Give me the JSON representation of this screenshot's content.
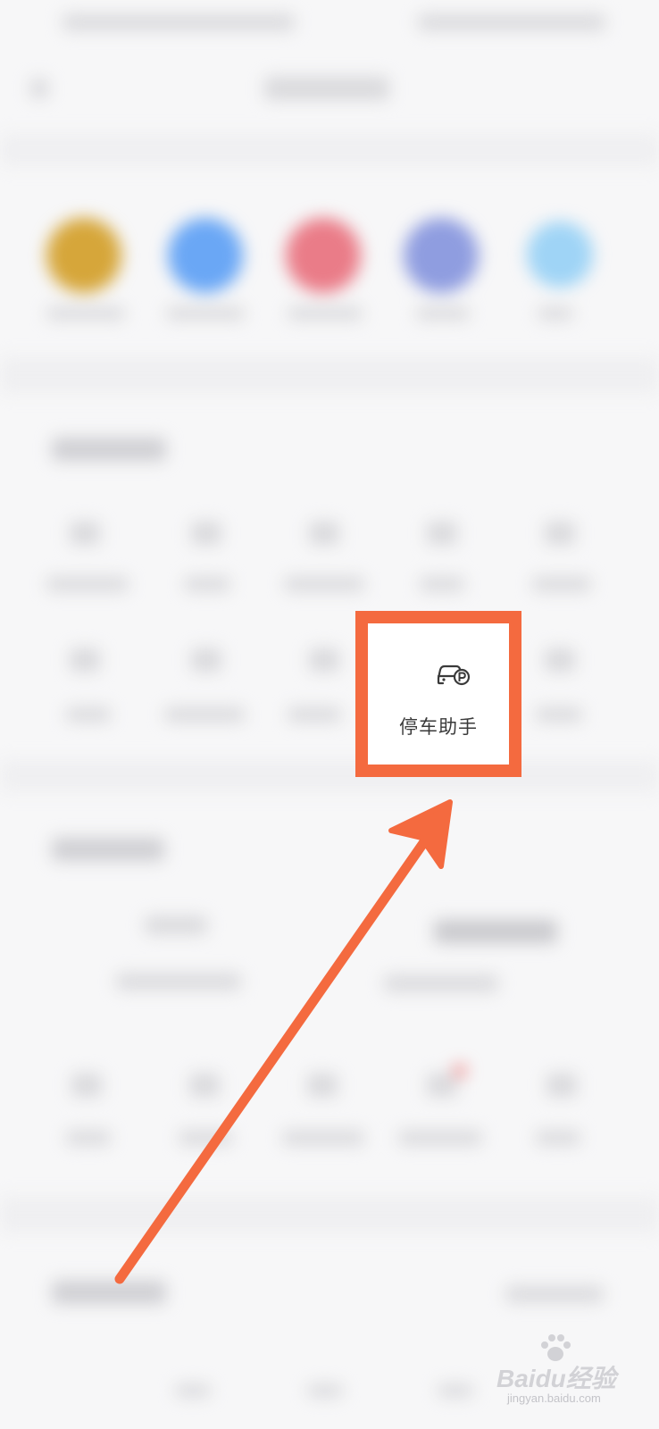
{
  "feature": {
    "label": "停车助手",
    "icon": "parking-car-icon"
  },
  "watermark": {
    "main": "Baidu经验",
    "sub": "jingyan.baidu.com"
  },
  "colors": {
    "highlight": "#f46a3f",
    "label_text": "#3a3a3a"
  }
}
